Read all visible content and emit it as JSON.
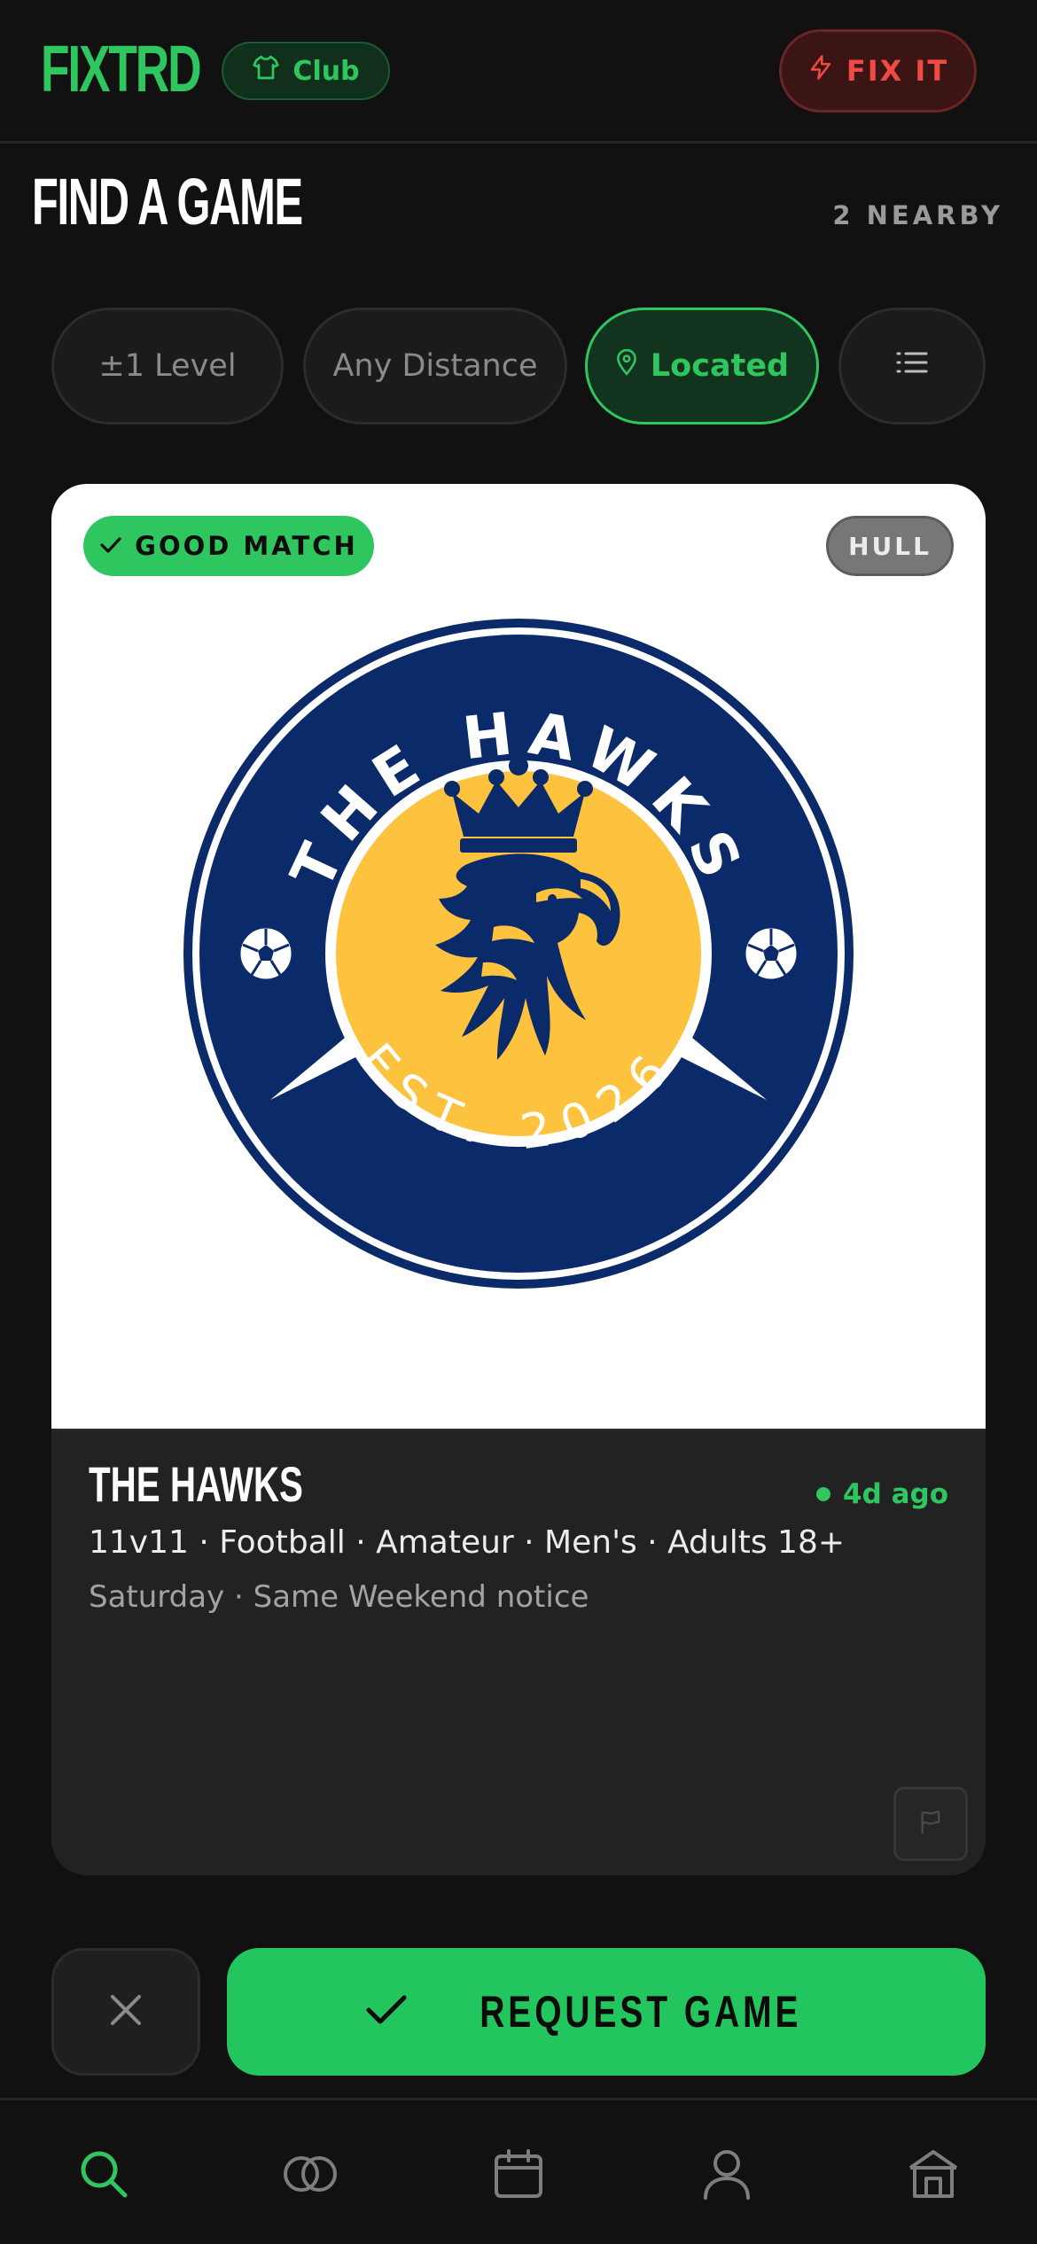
{
  "header": {
    "logo": "FIXTRD",
    "club_label": "Club",
    "fixit_label": "FIX IT"
  },
  "page": {
    "title": "FIND A GAME",
    "nearby_count": "2 NEARBY"
  },
  "filters": [
    {
      "label": "±1 Level",
      "active": false
    },
    {
      "label": "Any Distance",
      "active": false
    },
    {
      "label": "Located",
      "active": true,
      "icon": "map-pin-icon"
    },
    {
      "label": "",
      "icon": "list-icon"
    }
  ],
  "card": {
    "match_badge": "GOOD MATCH",
    "location_badge": "HULL",
    "crest": {
      "top_text": "THE HAWKS",
      "bottom_text": "EST. 2026",
      "colors": {
        "navy": "#0b2a6a",
        "gold": "#fdc33f",
        "white": "#ffffff"
      }
    },
    "team_name": "THE HAWKS",
    "posted": "4d ago",
    "details": "11v11 · Football · Amateur · Men's · Adults 18+",
    "schedule": "Saturday · Same Weekend notice"
  },
  "actions": {
    "request_label": "REQUEST GAME"
  },
  "tabs": [
    {
      "name": "search-icon",
      "active": true
    },
    {
      "name": "matches-icon",
      "active": false
    },
    {
      "name": "calendar-icon",
      "active": false
    },
    {
      "name": "profile-icon",
      "active": false
    },
    {
      "name": "home-icon",
      "active": false
    }
  ],
  "colors": {
    "accent": "#2fc55f",
    "danger": "#ef4a44",
    "background": "#111111",
    "card": "#222222"
  }
}
